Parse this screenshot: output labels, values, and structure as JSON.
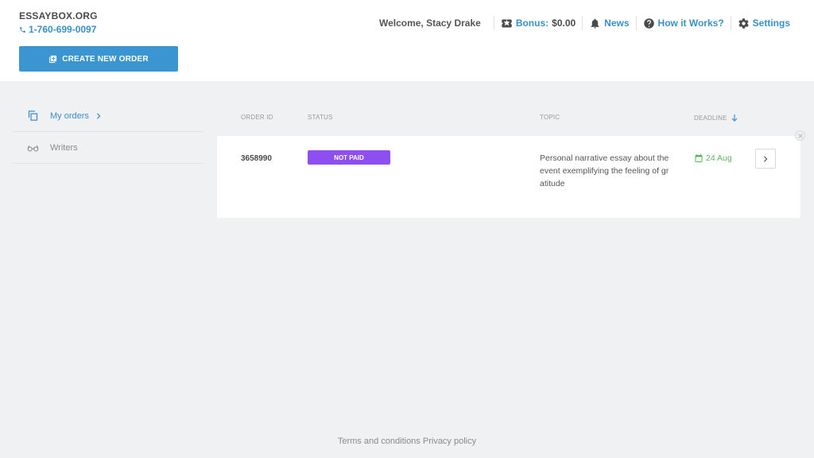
{
  "header": {
    "brand": "ESSAYBOX.ORG",
    "phone": "1-760-699-0097",
    "create_order_label": "CREATE NEW ORDER"
  },
  "topnav": {
    "welcome": "Welcome, Stacy Drake",
    "bonus_label": "Bonus:",
    "bonus_value": "$0.00",
    "news": "News",
    "how_it_works": "How it Works?",
    "settings": "Settings"
  },
  "sidebar": {
    "items": [
      {
        "label": "My orders",
        "icon": "copy-icon",
        "active": true
      },
      {
        "label": "Writers",
        "icon": "glasses-icon",
        "active": false
      }
    ]
  },
  "table": {
    "headers": {
      "order_id": "ORDER ID",
      "status": "STATUS",
      "topic": "TOPIC",
      "deadline": "DEADLINE"
    },
    "rows": [
      {
        "order_id": "3658990",
        "status": "NOT PAID",
        "topic": "Personal narrative essay about the event exemplifying the feeling of gratitude",
        "deadline": "24 Aug"
      }
    ]
  },
  "footer": {
    "terms": "Terms and conditions",
    "privacy": "Privacy policy"
  },
  "colors": {
    "accent": "#3a95d1",
    "status_not_paid": "#8e4ff0",
    "deadline": "#5cb85c",
    "background": "#f0f1f2"
  }
}
